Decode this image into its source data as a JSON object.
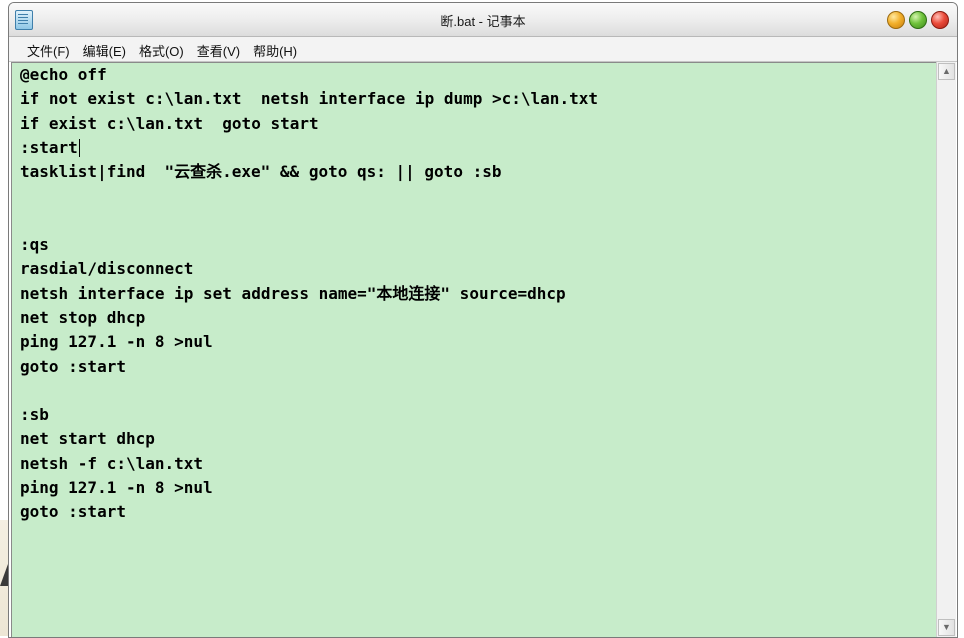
{
  "window": {
    "title": "断.bat - 记事本"
  },
  "menubar": {
    "items": [
      {
        "label": "文件(F)"
      },
      {
        "label": "编辑(E)"
      },
      {
        "label": "格式(O)"
      },
      {
        "label": "查看(V)"
      },
      {
        "label": "帮助(H)"
      }
    ]
  },
  "editor": {
    "background_color": "#c7ecca",
    "lines": [
      "@echo off",
      "if not exist c:\\lan.txt  netsh interface ip dump >c:\\lan.txt",
      "if exist c:\\lan.txt  goto start",
      ":start",
      "tasklist|find  \"云查杀.exe\" && goto qs: || goto :sb",
      "",
      "",
      ":qs",
      "rasdial/disconnect",
      "netsh interface ip set address name=\"本地连接\" source=dhcp",
      "net stop dhcp",
      "ping 127.1 -n 8 >nul",
      "goto :start",
      "",
      ":sb",
      "net start dhcp",
      "netsh -f c:\\lan.txt",
      "ping 127.1 -n 8 >nul",
      "goto :start"
    ],
    "caret_line": 3
  },
  "scrollbar": {
    "up_icon": "chevron-up-icon",
    "down_icon": "chevron-down-icon"
  }
}
